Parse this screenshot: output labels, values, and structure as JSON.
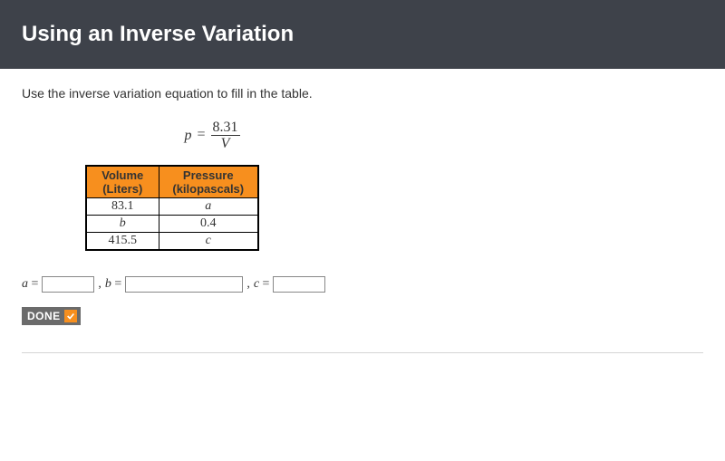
{
  "header": {
    "title": "Using an Inverse Variation"
  },
  "instruction": "Use the inverse variation equation to fill in the table.",
  "equation": {
    "left_var": "p",
    "equals": "=",
    "numerator": "8.31",
    "denominator": "V"
  },
  "table": {
    "headers": {
      "volume_line1": "Volume",
      "volume_line2": "(Liters)",
      "pressure_line1": "Pressure",
      "pressure_line2": "(kilopascals)"
    },
    "rows": [
      {
        "volume": "83.1",
        "pressure": "a",
        "pressure_italic": true
      },
      {
        "volume": "b",
        "pressure": "0.4",
        "volume_italic": true
      },
      {
        "volume": "415.5",
        "pressure": "c",
        "pressure_italic": true
      }
    ]
  },
  "answers": {
    "a_label_var": "a",
    "a_label_eq": " = ",
    "b_label_var": "b",
    "b_label_eq": " = ",
    "c_label_var": "c",
    "c_label_eq": " = ",
    "sep": ", "
  },
  "inputs": {
    "a_value": "",
    "b_value": "",
    "c_value": ""
  },
  "done_button": {
    "label": "DONE"
  }
}
